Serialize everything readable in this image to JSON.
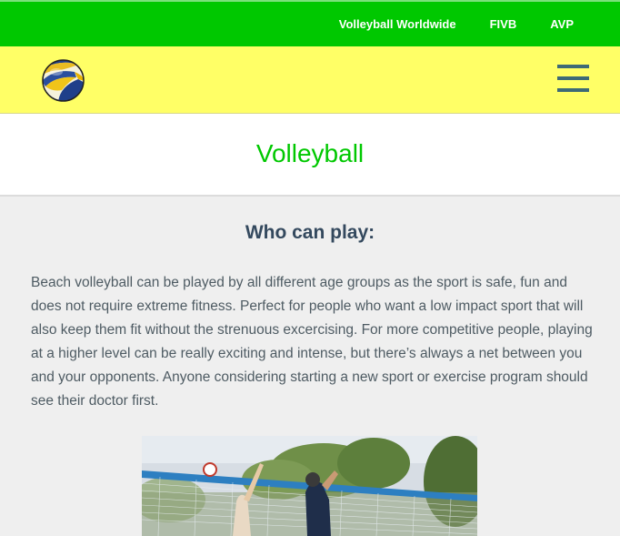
{
  "topnav": {
    "links": [
      "Volleyball Worldwide",
      "FIVB",
      "AVP"
    ]
  },
  "navbar": {
    "logo_icon": "volleyball-logo-icon",
    "menu_icon": "hamburger-menu-icon"
  },
  "page": {
    "title": "Volleyball"
  },
  "section": {
    "heading": "Who can play:",
    "body": "Beach volleyball can be played by all different age groups as the sport is safe, fun and does not require extreme fitness. Perfect for people who want a low impact sport that will also keep them fit without the strenuous excercising. For more competitive people, playing at a higher level can be really exciting and intense, but there’s always a net between you and your opponents. Anyone considering starting a new sport or exercise program should see their doctor first."
  },
  "colors": {
    "topbar": "#00c800",
    "navbar": "#ffff66",
    "title": "#00c800",
    "heading": "#34495e",
    "menu_icon": "#3e6a76"
  }
}
